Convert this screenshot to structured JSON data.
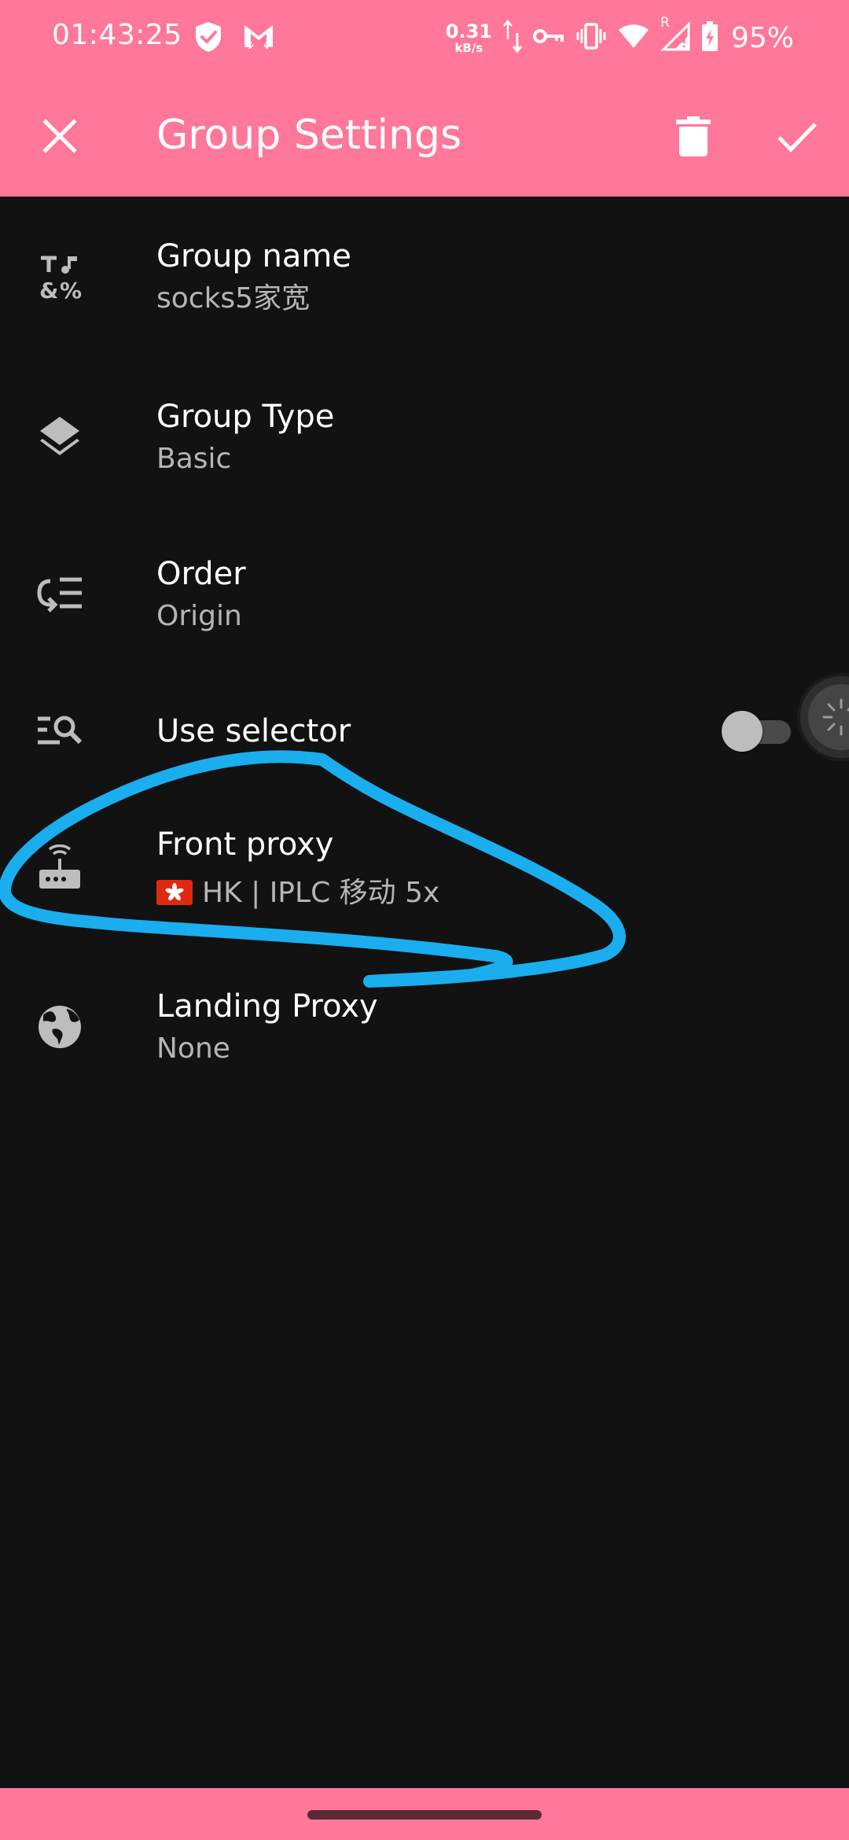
{
  "status_bar": {
    "time": "01:43:25",
    "net_speed_value": "0.31",
    "net_speed_unit": "kB/s",
    "roaming_indicator": "R",
    "battery_percent": "95%",
    "icons": [
      "shield-icon",
      "gmail-icon",
      "data-arrows-icon",
      "vpn-key-icon",
      "vibrate-icon",
      "wifi-icon",
      "cell-signal-icon",
      "battery-charging-icon"
    ]
  },
  "app_bar": {
    "title": "Group Settings",
    "close_icon": "close-icon",
    "delete_icon": "delete-icon",
    "confirm_icon": "check-icon"
  },
  "settings": {
    "group_name": {
      "title": "Group name",
      "summary": "socks5家宽",
      "icon": "text-symbols-icon"
    },
    "group_type": {
      "title": "Group Type",
      "summary": "Basic",
      "icon": "layers-icon"
    },
    "order": {
      "title": "Order",
      "summary": "Origin",
      "icon": "sort-order-icon"
    },
    "use_selector": {
      "title": "Use selector",
      "enabled": false,
      "icon": "list-search-icon"
    },
    "front_proxy": {
      "title": "Front proxy",
      "summary": "HK | IPLC 移动 5x",
      "flag": "hong-kong-flag-icon",
      "icon": "router-icon"
    },
    "landing_proxy": {
      "title": "Landing Proxy",
      "summary": "None",
      "icon": "globe-icon"
    }
  },
  "colors": {
    "accent": "#FF7799",
    "background": "#121212",
    "annotation_stroke": "#1AAEEF",
    "secondary_text": "#B5B5B5"
  }
}
